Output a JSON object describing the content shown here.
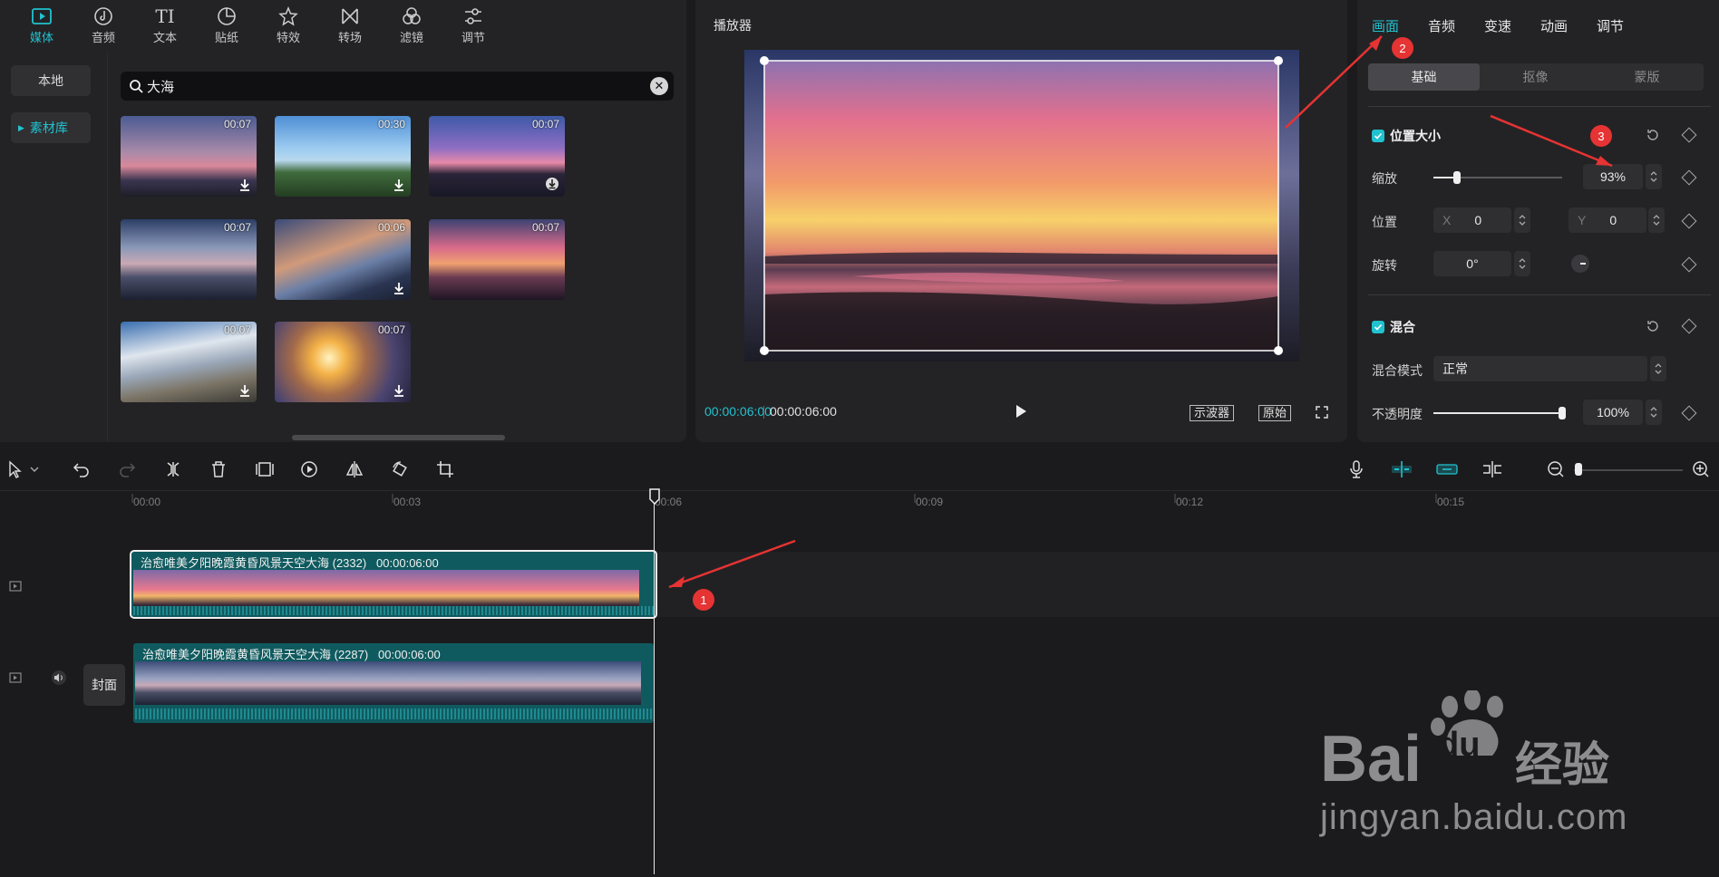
{
  "media_panel": {
    "tabs": [
      {
        "label": "媒体",
        "icon": "media-icon",
        "active": true
      },
      {
        "label": "音频",
        "icon": "audio-icon"
      },
      {
        "label": "文本",
        "icon": "text-icon"
      },
      {
        "label": "贴纸",
        "icon": "sticker-icon"
      },
      {
        "label": "特效",
        "icon": "effects-icon"
      },
      {
        "label": "转场",
        "icon": "transition-icon"
      },
      {
        "label": "滤镜",
        "icon": "filter-icon"
      },
      {
        "label": "调节",
        "icon": "adjust-icon"
      }
    ],
    "side": {
      "local": "本地",
      "library": "素材库"
    },
    "search": {
      "value": "大海"
    },
    "thumbnails": [
      {
        "duration": "00:07"
      },
      {
        "duration": "00:30"
      },
      {
        "duration": "00:07"
      },
      {
        "duration": "00:07"
      },
      {
        "duration": "00:06"
      },
      {
        "duration": "00:07"
      },
      {
        "duration": "00:07"
      },
      {
        "duration": "00:07"
      }
    ]
  },
  "player": {
    "title": "播放器",
    "time_current": "00:00:06:00",
    "time_total": "00:00:06:00",
    "scope_label": "示波器",
    "original_label": "原始"
  },
  "properties": {
    "tabs": [
      "画面",
      "音频",
      "变速",
      "动画",
      "调节"
    ],
    "active_tab": "画面",
    "sub_tabs": [
      "基础",
      "抠像",
      "蒙版"
    ],
    "position_size": {
      "title": "位置大小",
      "scale_label": "缩放",
      "scale_value": "93%",
      "scale_fraction": 0.18,
      "position_label": "位置",
      "x_label": "X",
      "x_value": "0",
      "y_label": "Y",
      "y_value": "0",
      "rotate_label": "旋转",
      "rotate_value": "0°"
    },
    "blend": {
      "title": "混合",
      "mode_label": "混合模式",
      "mode_value": "正常",
      "opacity_label": "不透明度",
      "opacity_value": "100%",
      "opacity_fraction": 1.0
    }
  },
  "timeline": {
    "ticks": [
      "00:00",
      "00:03",
      "00:06",
      "00:09",
      "00:12",
      "00:15"
    ],
    "clips": [
      {
        "title": "治愈唯美夕阳晚霞黄昏风景天空大海 (2332)",
        "duration": "00:00:06:00"
      },
      {
        "title": "治愈唯美夕阳晚霞黄昏风景天空大海 (2287)",
        "duration": "00:00:06:00"
      }
    ],
    "cover_label": "封面"
  },
  "annotations": [
    "1",
    "2",
    "3"
  ],
  "watermark": {
    "logo": "Bai du 经验",
    "url": "jingyan.baidu.com"
  },
  "colors": {
    "accent": "#21c2d0",
    "annotation": "#e63333",
    "clip": "#0f5a5f"
  }
}
